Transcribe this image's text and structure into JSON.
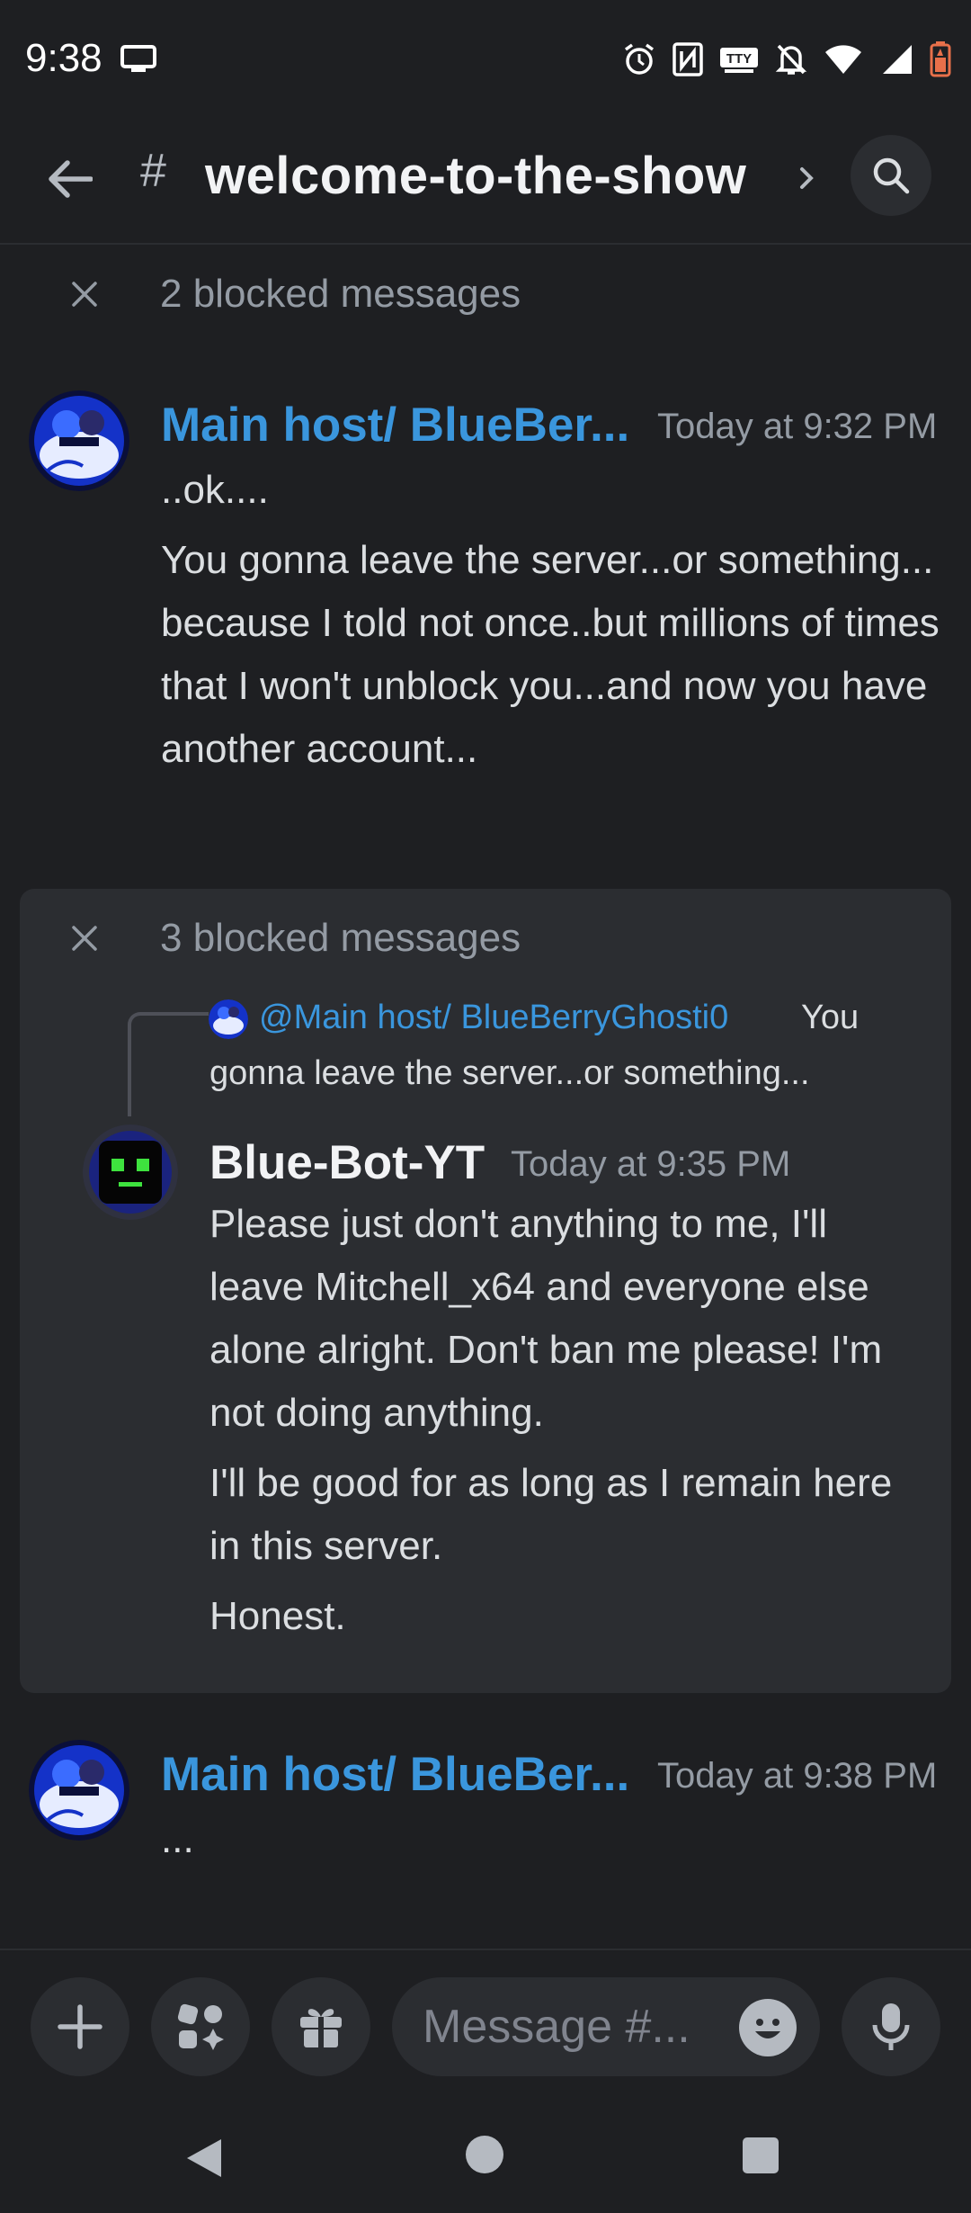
{
  "status_bar": {
    "time": "9:38",
    "icons": [
      "screen-icon",
      "alarm-icon",
      "nfc-icon",
      "tty-icon",
      "bell-off-icon",
      "wifi-icon",
      "signal-icon",
      "battery-icon"
    ],
    "tty_label": "TTY"
  },
  "header": {
    "hash": "#",
    "channel_name": "welcome-to-the-show"
  },
  "messages": {
    "blocked_1": "2 blocked messages",
    "msg1": {
      "author": "Main host/ BlueBer...",
      "timestamp": "Today at 9:32 PM",
      "line1": "..ok....",
      "body": "You gonna leave the server...or something... because I told not once..but millions of times that I won't unblock you...and now you have another account..."
    },
    "blocked_2": "3 blocked messages",
    "reply": {
      "mention": "@Main host/ BlueBerryGhosti0",
      "text_part1": "You",
      "text_part2": "gonna leave the server...or something..."
    },
    "msg2": {
      "author": "Blue-Bot-YT",
      "timestamp": "Today at 9:35 PM",
      "body1": "Please just don't anything to me, I'll leave Mitchell_x64 and everyone else alone alright. Don't ban me please! I'm not doing anything.",
      "body2": "I'll be good for as long as I remain here in this server.",
      "body3": "Honest."
    },
    "msg3": {
      "author": "Main host/ BlueBer...",
      "timestamp": "Today at 9:38 PM",
      "body": "..."
    }
  },
  "composer": {
    "placeholder": "Message #...",
    "buttons": [
      "plus-icon",
      "apps-icon",
      "gift-icon",
      "emoji-icon",
      "microphone-icon"
    ]
  },
  "colors": {
    "background": "#1e1f22",
    "panel": "#2b2d31",
    "username_blue": "#3a96dd",
    "muted": "#949ba4",
    "battery_orange": "#e8704a"
  }
}
